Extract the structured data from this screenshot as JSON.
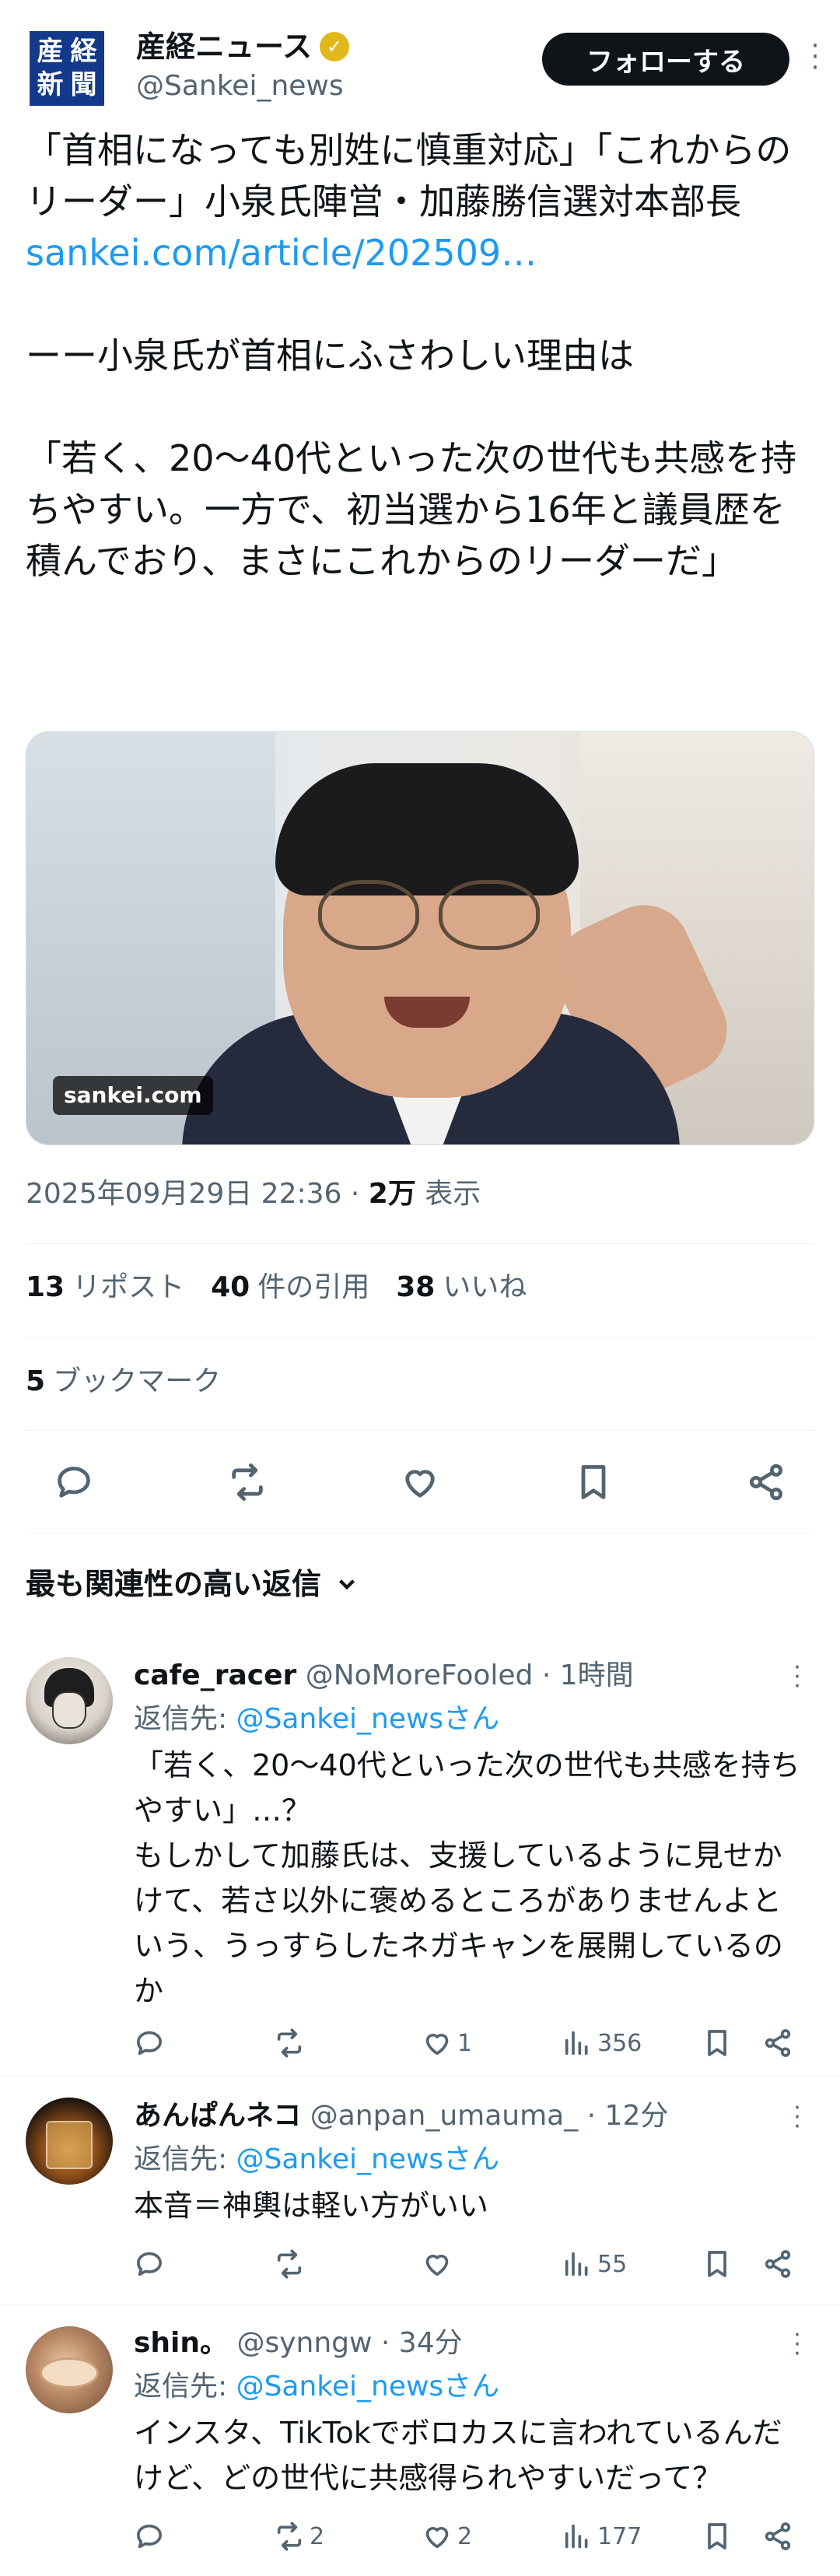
{
  "author": {
    "avatar_chars": [
      "産",
      "経",
      "新",
      "聞"
    ],
    "name": "産経ニュース",
    "handle": "@Sankei_news",
    "follow_label": "フォローする"
  },
  "tweet": {
    "headline": "「首相になっても別姓に慎重対応」「これからのリーダー」小泉氏陣営・加藤勝信選対本部長",
    "link": "sankei.com/article/202509…",
    "question": "ーー小泉氏が首相にふさわしい理由は",
    "quote": "「若く、20〜40代といった次の世代も共感を持ちやすい。一方で、初当選から16年と議員歴を積んでおり、まさにこれからのリーダーだ」",
    "media_source": "sankei.com",
    "timestamp": "2025年09月29日 22:36 · ",
    "views_count": "2万",
    "views_label": " 表示"
  },
  "stats": {
    "reposts_count": "13",
    "reposts_label": "リポスト",
    "quotes_count": "40",
    "quotes_label": "件の引用",
    "likes_count": "38",
    "likes_label": "いいね",
    "bookmarks_count": "5",
    "bookmarks_label": "ブックマーク"
  },
  "actions": {
    "icons": [
      "reply-icon",
      "repost-icon",
      "like-icon",
      "bookmark-icon",
      "share-icon"
    ]
  },
  "replies_sort": "最も関連性の高い返信",
  "replies": [
    {
      "name": "cafe_racer",
      "meta": " @NoMoreFooled · 1時間",
      "reply_to_prefix": "返信先: ",
      "reply_to": "@Sankei_newsさん",
      "text": "「若く、20〜40代といった次の世代も共感を持ちやすい」…？\nもしかして加藤氏は、支援しているように見せかけて、若さ以外に褒めるところがありませんよという、うっすらしたネガキャンを展開しているのか",
      "reposts": "",
      "likes": "1",
      "views": "356"
    },
    {
      "name": "あんぱんネコ",
      "meta": " @anpan_umauma_ · 12分",
      "reply_to_prefix": "返信先: ",
      "reply_to": "@Sankei_newsさん",
      "text": "本音＝神輿は軽い方がいい",
      "reposts": "",
      "likes": "",
      "views": "55"
    },
    {
      "name": "shin。",
      "meta": " @synngw · 34分",
      "reply_to_prefix": "返信先: ",
      "reply_to": "@Sankei_newsさん",
      "text": "インスタ、TikTokでボロカスに言われているんだけど、どの世代に共感得られやすいだって？",
      "reposts": "2",
      "likes": "2",
      "views": "177"
    }
  ]
}
